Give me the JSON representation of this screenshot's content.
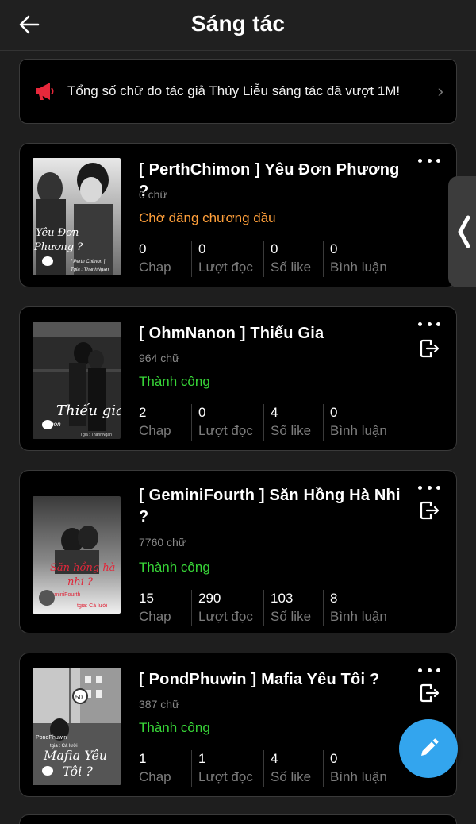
{
  "header": {
    "title": "Sáng tác",
    "back_icon": "arrow-left-icon"
  },
  "notice": {
    "icon": "megaphone-icon",
    "icon_color": "#e8283b",
    "text": "Tổng số chữ do tác giả Thúy Liễu sáng tác đã vượt 1M!"
  },
  "stat_labels": {
    "chap": "Chap",
    "views": "Lượt đọc",
    "likes": "Số like",
    "comments": "Bình luận"
  },
  "works": [
    {
      "title": "[ PerthChimon ] Yêu Đơn Phương ?",
      "words": "0 chữ",
      "status": "Chờ đăng chương đầu",
      "status_color": "#ff9f3a",
      "cover_text": "Yêu Đơn Phương ?",
      "cover_credit": "[ Perth Chimon ]",
      "cover_author": "Tgia : ThanhNgan",
      "stats": {
        "chap": "0",
        "views": "0",
        "likes": "0",
        "comments": "0"
      }
    },
    {
      "title": "[ OhmNanon ] Thiếu Gia",
      "words": "964 chữ",
      "status": "Thành công",
      "status_color": "#38d638",
      "cover_text": "Thiếu gia",
      "cover_credit": "Nanon",
      "cover_author": "Tgia : ThanhNgan",
      "stats": {
        "chap": "2",
        "views": "0",
        "likes": "4",
        "comments": "0"
      }
    },
    {
      "title": "[ GeminiFourth ] Săn Hồng Hà Nhi ?",
      "words": "7760 chữ",
      "status": "Thành công",
      "status_color": "#38d638",
      "cover_text": "Săn hồng hà nhi ?",
      "cover_credit": "GeminiFourth",
      "cover_author": "tgia: Cá lười",
      "stats": {
        "chap": "15",
        "views": "290",
        "likes": "103",
        "comments": "8"
      }
    },
    {
      "title": "[ PondPhuwin ] Mafia Yêu Tôi ?",
      "words": "387 chữ",
      "status": "Thành công",
      "status_color": "#38d638",
      "cover_text": "Mafia Yêu Tôi ?",
      "cover_credit": "PondPhuwin",
      "cover_author": "tgia : Cá lười",
      "stats": {
        "chap": "1",
        "views": "1",
        "likes": "4",
        "comments": "0"
      }
    }
  ],
  "fab": {
    "icon": "pencil-icon",
    "color": "#33a5ee"
  },
  "side_handle": {
    "icon": "chevron-left-icon"
  }
}
